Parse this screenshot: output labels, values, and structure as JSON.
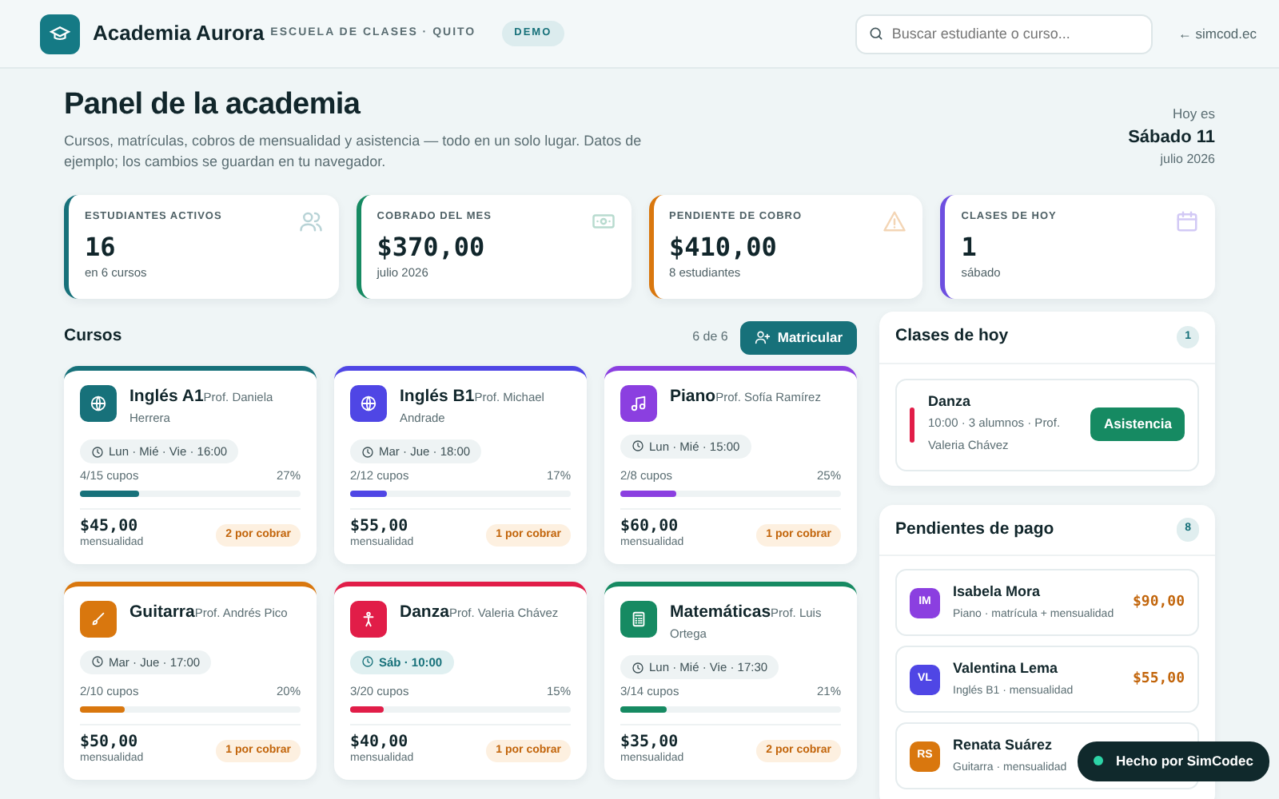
{
  "header": {
    "logo_title": "Academia Aurora",
    "subtitle": "ESCUELA DE CLASES · QUITO",
    "badge": "DEMO",
    "search": {
      "placeholder": "Buscar estudiante o curso..."
    },
    "back_link": "← simcod.ec"
  },
  "page": {
    "title": "Panel de la academia",
    "description": "Cursos, matrículas, cobros de mensualidad y asistencia — todo en un solo lugar. Datos de ejemplo; los cambios se guardan en tu navegador.",
    "today_label": "Hoy es",
    "today_day": "Sábado 11",
    "today_month": "julio 2026"
  },
  "stats": [
    {
      "label": "ESTUDIANTES ACTIVOS",
      "value": "16",
      "sub": "en 6 cursos",
      "color": "#17717a"
    },
    {
      "label": "COBRADO DEL MES",
      "value": "$370,00",
      "sub": "julio 2026",
      "color": "#168a62"
    },
    {
      "label": "PENDIENTE DE COBRO",
      "value": "$410,00",
      "sub": "8 estudiantes",
      "color": "#d9770e"
    },
    {
      "label": "CLASES DE HOY",
      "value": "1",
      "sub": "sábado",
      "color": "#6d4fe0"
    }
  ],
  "courses_section": {
    "title": "Cursos",
    "count": "6 de 6",
    "button": "Matricular"
  },
  "courses": [
    {
      "name": "Inglés A1",
      "teacher": "Prof. Daniela Herrera",
      "schedule": "Lun · Mié · Vie · 16:00",
      "today": false,
      "seats": "4/15 cupos",
      "percent": "27%",
      "level": 0.27,
      "price": "$45,00",
      "price_label": "mensualidad",
      "due": "2 por cobrar",
      "color": "#17717a"
    },
    {
      "name": "Inglés B1",
      "teacher": "Prof. Michael Andrade",
      "schedule": "Mar · Jue · 18:00",
      "today": false,
      "seats": "2/12 cupos",
      "percent": "17%",
      "level": 0.17,
      "price": "$55,00",
      "price_label": "mensualidad",
      "due": "1 por cobrar",
      "color": "#4f46e5"
    },
    {
      "name": "Piano",
      "teacher": "Prof. Sofía Ramírez",
      "schedule": "Lun · Mié · 15:00",
      "today": false,
      "seats": "2/8 cupos",
      "percent": "25%",
      "level": 0.25,
      "price": "$60,00",
      "price_label": "mensualidad",
      "due": "1 por cobrar",
      "color": "#8b3fe0"
    },
    {
      "name": "Guitarra",
      "teacher": "Prof. Andrés Pico",
      "schedule": "Mar · Jue · 17:00",
      "today": false,
      "seats": "2/10 cupos",
      "percent": "20%",
      "level": 0.2,
      "price": "$50,00",
      "price_label": "mensualidad",
      "due": "1 por cobrar",
      "color": "#d9770e"
    },
    {
      "name": "Danza",
      "teacher": "Prof. Valeria Chávez",
      "schedule": "Sáb · 10:00",
      "today": true,
      "seats": "3/20 cupos",
      "percent": "15%",
      "level": 0.15,
      "price": "$40,00",
      "price_label": "mensualidad",
      "due": "1 por cobrar",
      "color": "#e11d48"
    },
    {
      "name": "Matemáticas",
      "teacher": "Prof. Luis Ortega",
      "schedule": "Lun · Mié · Vie · 17:30",
      "today": false,
      "seats": "3/14 cupos",
      "percent": "21%",
      "level": 0.21,
      "price": "$35,00",
      "price_label": "mensualidad",
      "due": "2 por cobrar",
      "color": "#168a62"
    }
  ],
  "today_classes": {
    "title": "Clases de hoy",
    "count": "1",
    "items": [
      {
        "name": "Danza",
        "detail": "10:00 · 3 alumnos · Prof. Valeria Chávez",
        "button": "Asistencia",
        "color": "#e11d48"
      }
    ]
  },
  "pending": {
    "title": "Pendientes de pago",
    "count": "8",
    "items": [
      {
        "initials": "IM",
        "name": "Isabela Mora",
        "detail": "Piano · matrícula + mensualidad",
        "amount": "$90,00",
        "color": "#8b3fe0"
      },
      {
        "initials": "VL",
        "name": "Valentina Lema",
        "detail": "Inglés B1 · mensualidad",
        "amount": "$55,00",
        "color": "#4f46e5"
      },
      {
        "initials": "RS",
        "name": "Renata Suárez",
        "detail": "Guitarra · mensualidad",
        "color": "#d9770e"
      }
    ]
  },
  "toast": {
    "text": "Hecho por SimCodec"
  }
}
